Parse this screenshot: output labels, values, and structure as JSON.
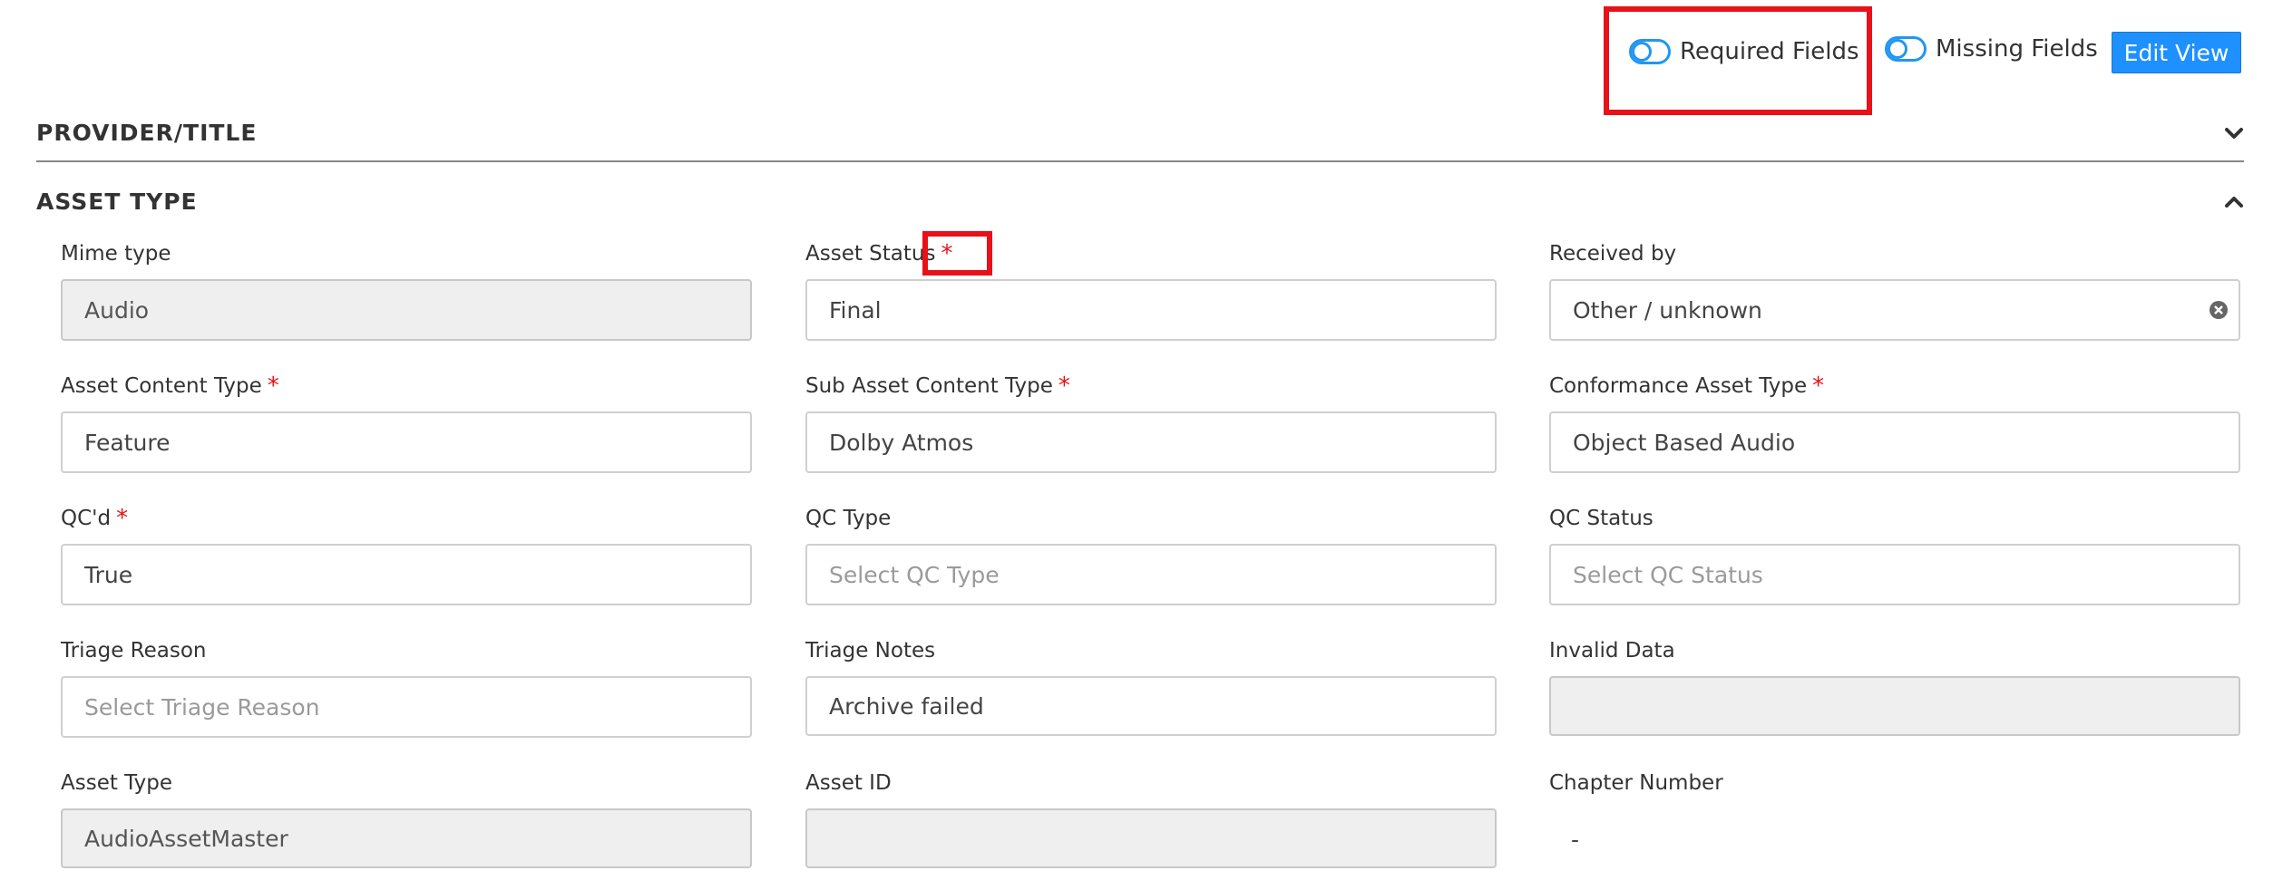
{
  "toolbar": {
    "required_fields_label": "Required Fields",
    "missing_fields_label": "Missing Fields",
    "edit_view_label": "Edit View"
  },
  "sections": {
    "provider_title": "PROVIDER/TITLE",
    "asset_type": "ASSET TYPE"
  },
  "fields": {
    "mime_type": {
      "label": "Mime type",
      "value": "Audio"
    },
    "asset_status": {
      "label": "Asset Status",
      "value": "Final"
    },
    "received_by": {
      "label": "Received by",
      "value": "Other / unknown"
    },
    "asset_content_type": {
      "label": "Asset Content Type",
      "value": "Feature"
    },
    "sub_asset_content_type": {
      "label": "Sub Asset Content Type",
      "value": "Dolby Atmos"
    },
    "conformance_asset_type": {
      "label": "Conformance Asset Type",
      "value": "Object Based Audio"
    },
    "qcd": {
      "label": "QC'd",
      "value": "True"
    },
    "qc_type": {
      "label": "QC Type",
      "placeholder": "Select QC Type"
    },
    "qc_status": {
      "label": "QC Status",
      "placeholder": "Select QC Status"
    },
    "triage_reason": {
      "label": "Triage Reason",
      "placeholder": "Select Triage Reason"
    },
    "triage_notes": {
      "label": "Triage Notes",
      "value": "Archive failed"
    },
    "invalid_data": {
      "label": "Invalid Data",
      "value": ""
    },
    "asset_type": {
      "label": "Asset Type",
      "value": "AudioAssetMaster"
    },
    "asset_id": {
      "label": "Asset ID",
      "value": ""
    },
    "chapter_number": {
      "label": "Chapter Number",
      "value": "-"
    }
  },
  "required_marker": "*",
  "colors": {
    "accent": "#1e90ff",
    "highlight": "#e8111a",
    "required": "#e8111a"
  }
}
